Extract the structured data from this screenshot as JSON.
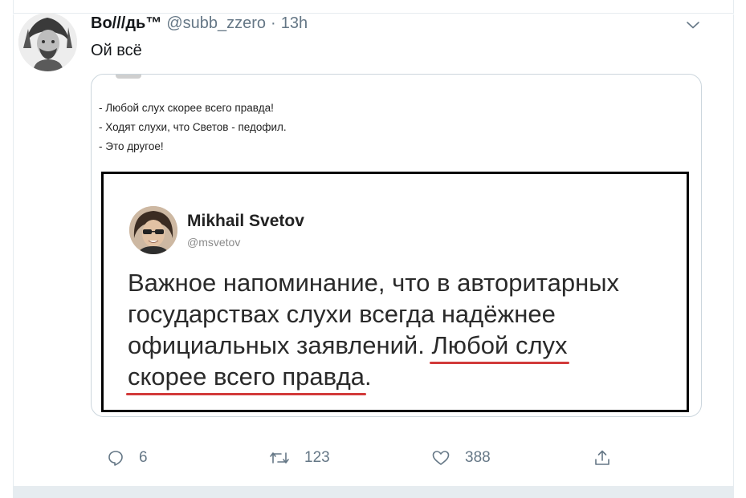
{
  "tweet": {
    "display_name": "Во///дь™",
    "handle": "@subb_zzero",
    "separator": "·",
    "time": "13h",
    "text": "Ой всё"
  },
  "media": {
    "dialog": [
      "- Любой слух скорее всего правда!",
      "- Ходят слухи, что Светов - педофил.",
      "- Это другое!"
    ],
    "quoted": {
      "name": "Mikhail Svetov",
      "handle": "@msvetov",
      "text_lines": [
        "Важное напоминание, что в авторитарных",
        "государствах слухи всегда надёжнее",
        "официальных заявлений.",
        "Любой слух",
        "скорее всего правда",
        "."
      ]
    }
  },
  "actions": {
    "replies": "6",
    "retweets": "123",
    "likes": "388"
  },
  "icons": {
    "reply": "reply-icon",
    "retweet": "retweet-icon",
    "like": "heart-icon",
    "share": "share-icon",
    "caret": "chevron-down-icon"
  },
  "colors": {
    "secondary_text": "#657786",
    "border": "#e6ecf0",
    "underline": "#d23a3a"
  }
}
